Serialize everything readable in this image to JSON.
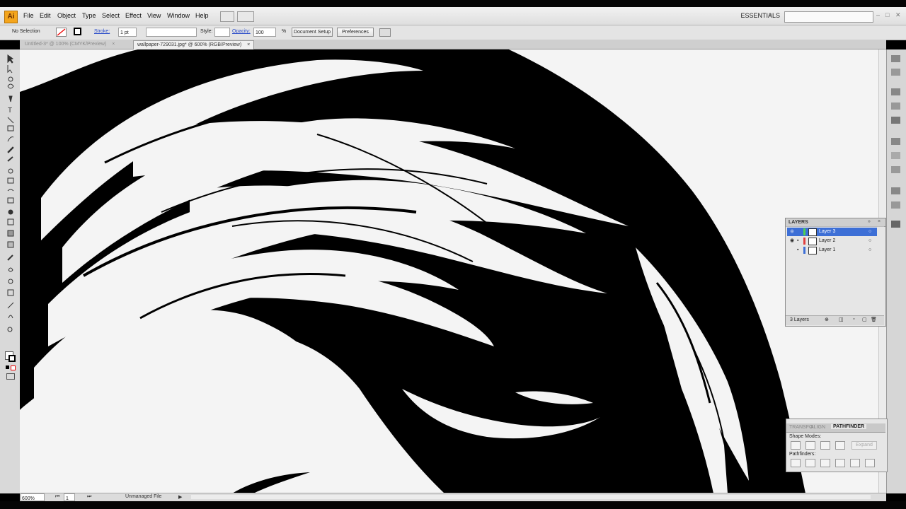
{
  "app": {
    "logo": "Ai"
  },
  "menu": [
    "File",
    "Edit",
    "Object",
    "Type",
    "Select",
    "Effect",
    "View",
    "Window",
    "Help"
  ],
  "workspace": {
    "label": "ESSENTIALS",
    "search_placeholder": ""
  },
  "control_bar": {
    "selection_label": "No Selection",
    "stroke_label": "Stroke:",
    "stroke_value": "1 pt",
    "style_label": "Style:",
    "opacity_label": "Opacity:",
    "opacity_value": "100",
    "opacity_unit": "%",
    "document_setup": "Document Setup",
    "preferences": "Preferences"
  },
  "tabs": [
    {
      "label": "Untitled-3* @ 100% (CMYK/Preview)",
      "active": false
    },
    {
      "label": "wallpaper-729031.jpg* @ 600% (RGB/Preview)",
      "active": true
    }
  ],
  "layers_panel": {
    "title": "LAYERS",
    "layers": [
      {
        "name": "Layer 3",
        "selected": true,
        "color": "#4fd24f"
      },
      {
        "name": "Layer 2",
        "selected": false,
        "color": "#e04040"
      },
      {
        "name": "Layer 1",
        "selected": false,
        "color": "#3d6fd6"
      }
    ],
    "count_label": "3 Layers"
  },
  "pathfinder_panel": {
    "tabs": [
      "TRANSFO",
      "ALIGN",
      "PATHFINDER"
    ],
    "shape_modes_label": "Shape Modes:",
    "expand_label": "Expand",
    "pathfinders_label": "Pathfinders:"
  },
  "status_bar": {
    "zoom": "600%",
    "page": "1",
    "info": "Unmanaged File"
  },
  "colors": {
    "selected_layer": "#3d6fd6",
    "canvas_bg": "#f4f4f4",
    "artwork": "#000000"
  }
}
